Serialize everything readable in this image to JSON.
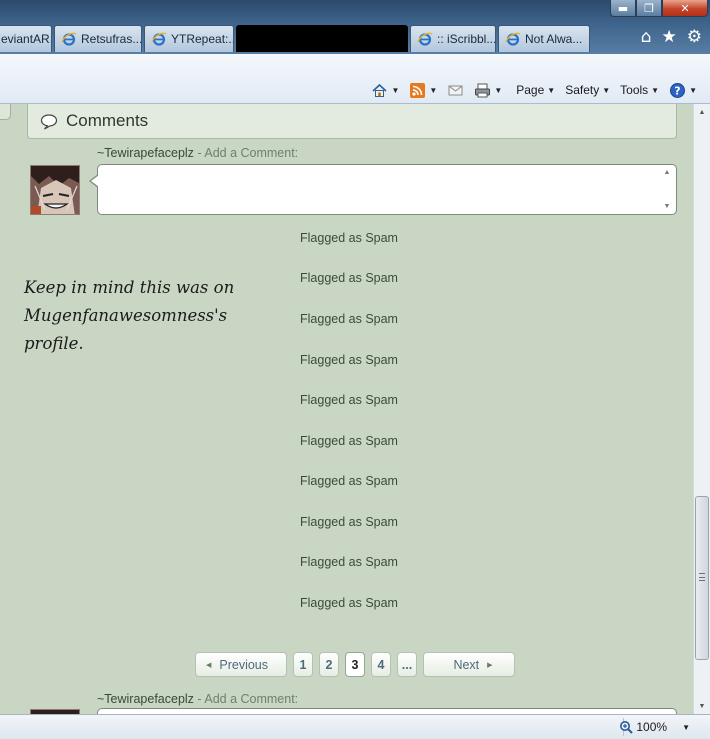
{
  "window": {
    "buttons": [
      "minimize",
      "restore",
      "close"
    ]
  },
  "tabs": [
    {
      "label": "eviantAR..."
    },
    {
      "label": "Retsufras..."
    },
    {
      "label": "YTRepeat:..."
    },
    {
      "label": "",
      "redacted": true
    },
    {
      "label": ":: iScribbl..."
    },
    {
      "label": "Not Alwa..."
    }
  ],
  "commandbar": {
    "page_label": "Page",
    "safety_label": "Safety",
    "tools_label": "Tools"
  },
  "comments": {
    "title": "Comments",
    "username": "~Tewirapefaceplz",
    "add_label": " - Add a Comment:",
    "spam_items": [
      "Flagged as Spam",
      "Flagged as Spam",
      "Flagged as Spam",
      "Flagged as Spam",
      "Flagged as Spam",
      "Flagged as Spam",
      "Flagged as Spam",
      "Flagged as Spam",
      "Flagged as Spam",
      "Flagged as Spam"
    ]
  },
  "note": "Keep in mind this was on Mugenfanawesomness's profile.",
  "pagination": {
    "previous": "Previous",
    "pages": [
      "1",
      "2",
      "3",
      "4"
    ],
    "current": "3",
    "ellipsis": "...",
    "next": "Next"
  },
  "status": {
    "zoom": "100%"
  },
  "colors": {
    "page_bg": "#c9d6c4",
    "link": "#4e6a7d",
    "titlebar": "#3d6289"
  }
}
